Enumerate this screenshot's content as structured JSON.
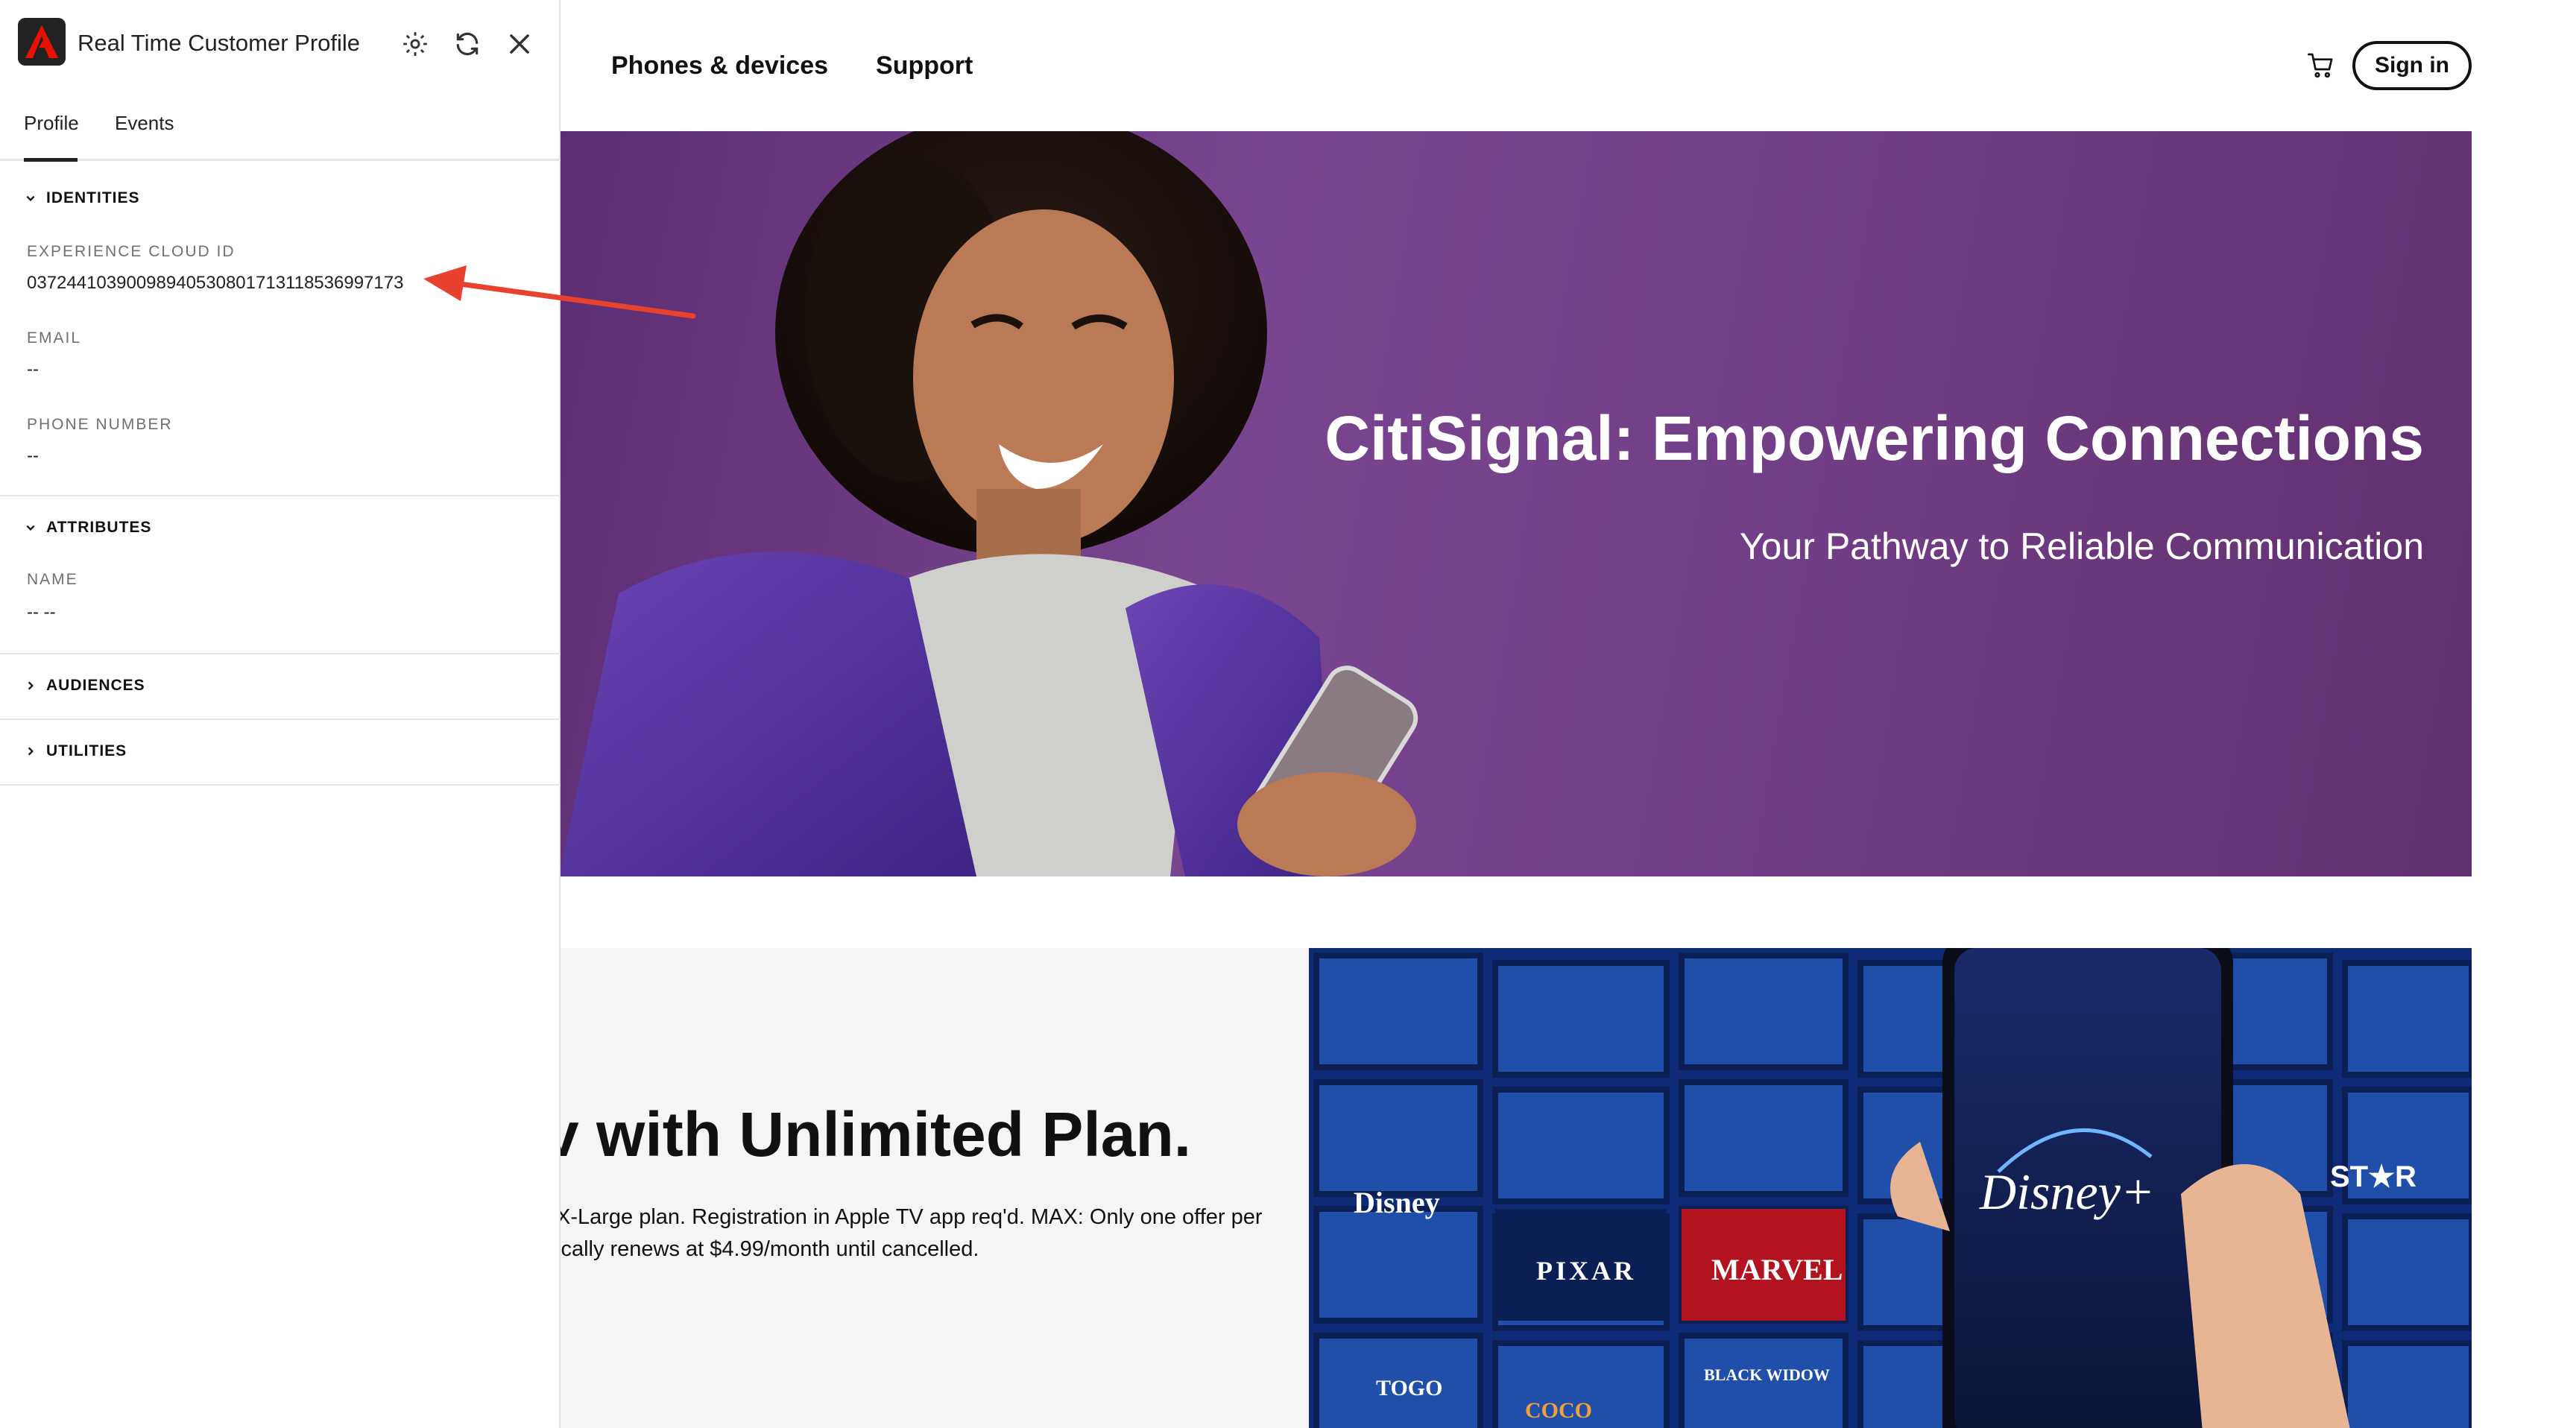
{
  "website": {
    "nav": [
      "Phones & devices",
      "Support"
    ],
    "sign_in": "Sign in",
    "hero": {
      "title": "CitiSignal: Empowering Connections",
      "subtitle": "Your Pathway to Reliable Communication"
    },
    "promo": {
      "title": "v with Unlimited Plan.",
      "text_line1": "X-Large plan. Registration in Apple TV app req'd. MAX: Only one offer per",
      "text_line2": "ically renews at $4.99/month until cancelled.",
      "phone_brand": "Disney+",
      "tiles": [
        "Disney",
        "PIXAR",
        "MARVEL",
        "ST★R",
        "BLACK WIDOW",
        "TOGO",
        "COCO"
      ]
    }
  },
  "panel": {
    "title": "Real Time Customer Profile",
    "icons": [
      "settings-gear-icon",
      "refresh-icon",
      "close-icon"
    ],
    "tabs": [
      "Profile",
      "Events"
    ],
    "active_tab": "Profile",
    "identities": {
      "heading": "IDENTITIES",
      "ecid_label": "EXPERIENCE CLOUD ID",
      "ecid_value": "03724410390098940530801713118536997173",
      "email_label": "EMAIL",
      "email_value": "--",
      "phone_label": "PHONE NUMBER",
      "phone_value": "--"
    },
    "attributes": {
      "heading": "ATTRIBUTES",
      "name_label": "NAME",
      "name_value": "-- --"
    },
    "audiences": {
      "heading": "AUDIENCES"
    },
    "utilities": {
      "heading": "UTILITIES"
    }
  },
  "colors": {
    "hero_purple": "#743f89",
    "annotation_red": "#e8412d",
    "logo_red": "#eb1000"
  }
}
